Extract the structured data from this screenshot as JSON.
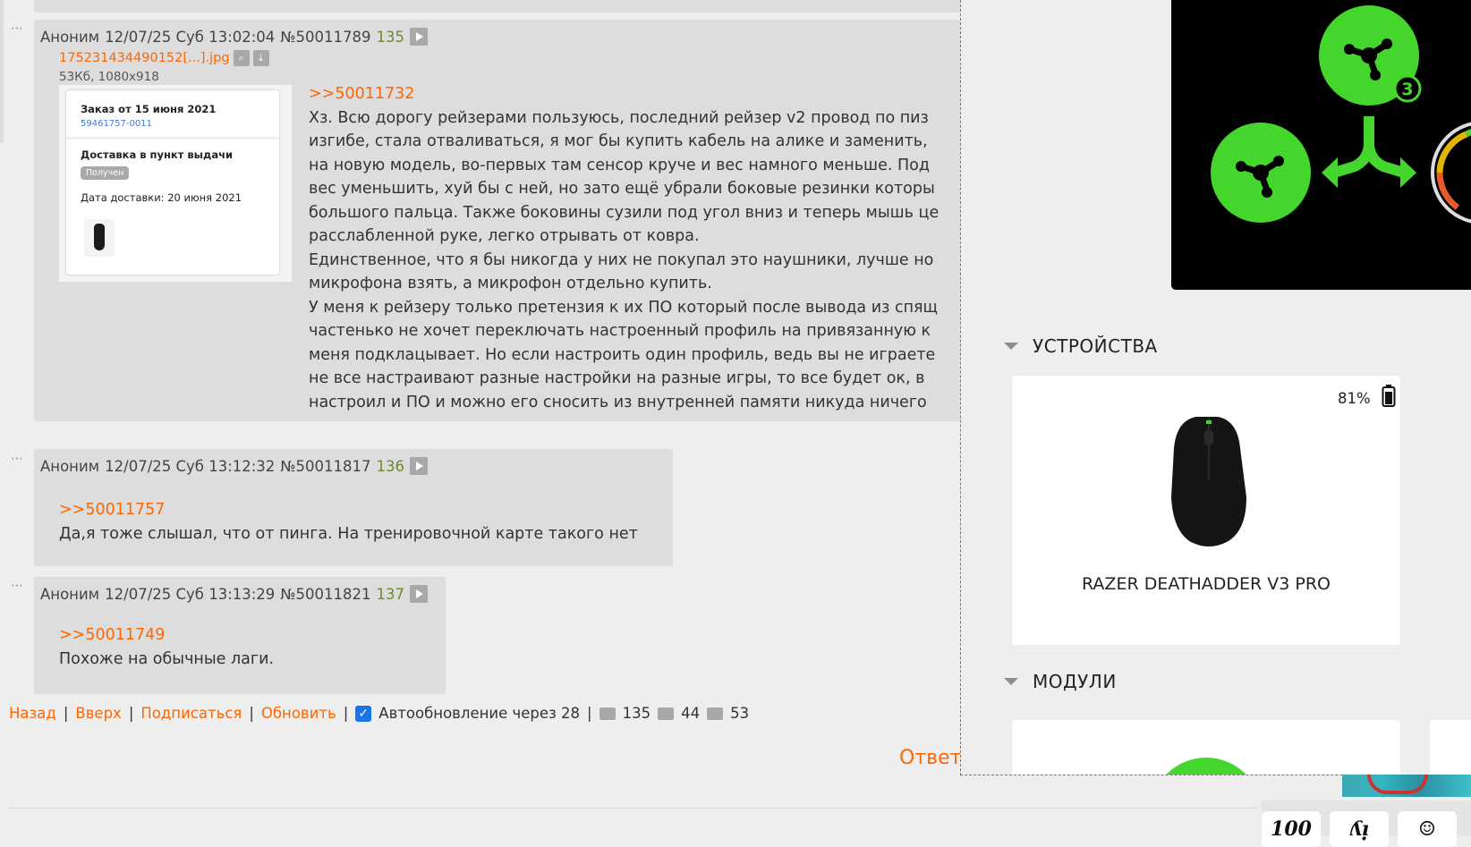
{
  "posts": [
    {
      "author": "Аноним",
      "date": "12/07/25 Суб 13:02:04",
      "num": "№50011789",
      "count": "135",
      "file": {
        "name": "175231434490152[...].jpg",
        "meta": "53Кб, 1080x918",
        "thumb": {
          "order_title": "Заказ от 15 июня 2021",
          "order_number": "59461757-0011",
          "delivery": "Доставка в пункт выдачи",
          "status": "Получен",
          "delivery_date": "Дата доставки: 20 июня 2021"
        }
      },
      "reply_to": ">>50011732",
      "lines": [
        "Хз. Всю дорогу рейзерами пользуюсь, последний рейзер v2 провод по пиз",
        "изгибе, стала отваливаться, я мог бы купить кабель на алике и заменить,",
        "на новую модель, во-первых там сенсор круче и вес намного меньше. Под",
        "вес уменьшить, хуй бы с ней, но зато ещё убрали боковые резинки которы",
        "большого пальца. Также боковины сузили под угол вниз и теперь мышь це",
        "расслабленной руке, легко отрывать от ковра.",
        "Единственное, что я бы никогда у них не покупал это наушники, лучше но",
        "микрофона взять, а микрофон отдельно купить.",
        "У меня к рейзеру только претензия к их ПО который после вывода из спящ",
        "частенько не хочет переключать настроенный профиль на привязанную к",
        "меня подклацывает. Но если настроить один профиль, ведь вы не играете",
        "не все настраивают разные настройки на разные игры, то все будет ок, в",
        "настроил и ПО и можно его сносить из внутренней памяти никуда ничего"
      ]
    },
    {
      "author": "Аноним",
      "date": "12/07/25 Суб 13:12:32",
      "num": "№50011817",
      "count": "136",
      "reply_to": ">>50011757",
      "lines": [
        "Да,я тоже слышал, что от пинга. На тренировочной карте такого нет"
      ]
    },
    {
      "author": "Аноним",
      "date": "12/07/25 Суб 13:13:29",
      "num": "№50011821",
      "count": "137",
      "reply_to": ">>50011749",
      "lines": [
        "Похоже на обычные лаги."
      ]
    }
  ],
  "footer": {
    "back": "Назад",
    "up": "Вверх",
    "subscribe": "Подписаться",
    "refresh": "Обновить",
    "autoupdate": "Автообновление через 28",
    "autoupdate_checked": true,
    "posts_count": "135",
    "images_count": "44",
    "users_count": "53",
    "reply": "Ответ"
  },
  "razer": {
    "hero_badge": "3",
    "colors": {
      "green": "#44d62c",
      "black": "#000000"
    },
    "devices_title": "УСТРОЙСТВА",
    "device": {
      "battery": "81%",
      "name": "RAZER DEATHADDER V3 PRO"
    },
    "modules_title": "МОДУЛИ"
  },
  "emotes": [
    "100",
    "ʎᴉ",
    "☺"
  ]
}
